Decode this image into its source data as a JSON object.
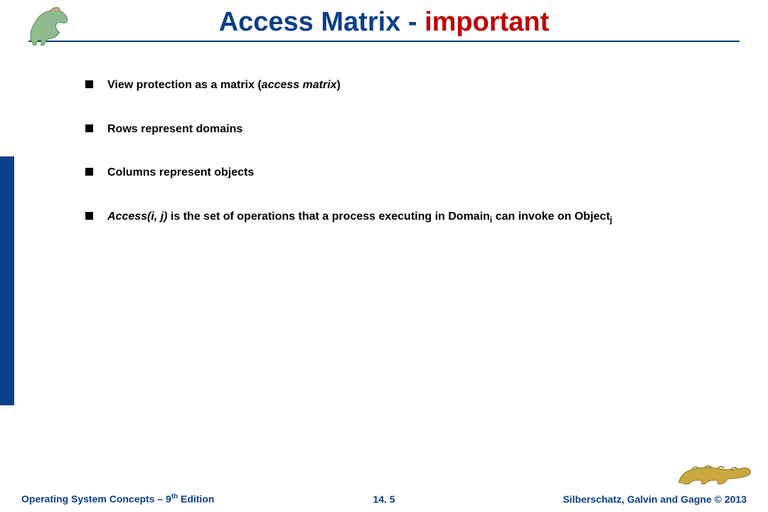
{
  "title": {
    "part1": "Access Matrix - ",
    "part2": "important"
  },
  "bullets": [
    {
      "pre": "View protection as a matrix (",
      "italic": "access matrix",
      "post": ")"
    },
    {
      "pre": "Rows represent domains",
      "italic": "",
      "post": ""
    },
    {
      "pre": "Columns represent objects",
      "italic": "",
      "post": ""
    }
  ],
  "bullet4": {
    "italic1": "Access(i, j)",
    "mid": " is the set of operations that a process executing in Domain",
    "sub1": "i",
    "mid2": " can invoke on Object",
    "sub2": "j"
  },
  "footer": {
    "left_prefix": "Operating System Concepts – 9",
    "left_sup": "th",
    "left_suffix": " Edition",
    "center": "14. 5",
    "right": "Silberschatz, Galvin and Gagne © 2013"
  }
}
